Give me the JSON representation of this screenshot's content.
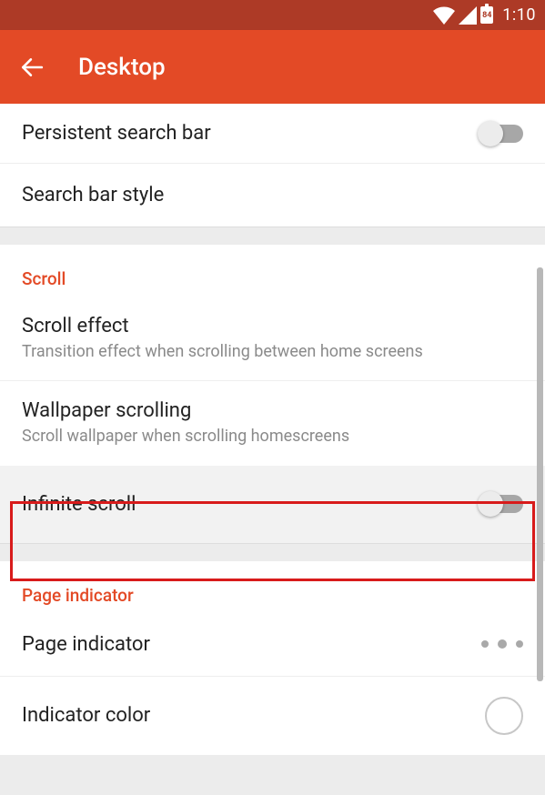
{
  "status": {
    "battery": "84",
    "time": "1:10"
  },
  "appbar": {
    "title": "Desktop"
  },
  "rows": {
    "persistent": "Persistent search bar",
    "searchstyle": "Search bar style"
  },
  "scroll": {
    "header": "Scroll",
    "effect": {
      "t": "Scroll effect",
      "s": "Transition effect when scrolling between home screens"
    },
    "wallpaper": {
      "t": "Wallpaper scrolling",
      "s": "Scroll wallpaper when scrolling homescreens"
    },
    "infinite": "Infinite scroll"
  },
  "page": {
    "header": "Page indicator",
    "indicator": "Page indicator",
    "color": "Indicator color"
  }
}
